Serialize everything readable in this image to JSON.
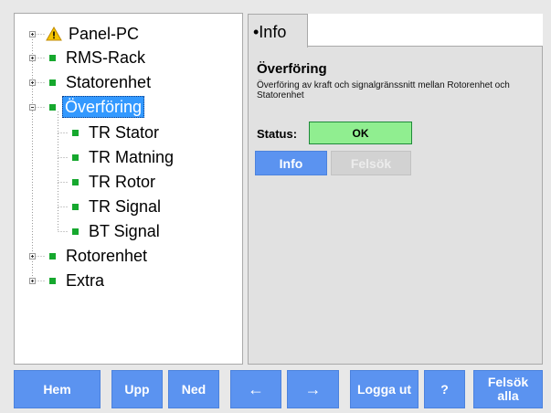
{
  "tree": {
    "items": [
      {
        "label": "Panel-PC",
        "icon": "warning-icon",
        "level": 0,
        "expandable": true,
        "selected": false
      },
      {
        "label": "RMS-Rack",
        "icon": "status-green-icon",
        "level": 0,
        "expandable": true,
        "selected": false
      },
      {
        "label": "Statorenhet",
        "icon": "status-green-icon",
        "level": 0,
        "expandable": true,
        "selected": false
      },
      {
        "label": "Överföring",
        "icon": "status-green-icon",
        "level": 0,
        "expandable": true,
        "selected": true
      },
      {
        "label": "TR Stator",
        "icon": "status-green-icon",
        "level": 1,
        "expandable": false,
        "selected": false
      },
      {
        "label": "TR Matning",
        "icon": "status-green-icon",
        "level": 1,
        "expandable": false,
        "selected": false
      },
      {
        "label": "TR Rotor",
        "icon": "status-green-icon",
        "level": 1,
        "expandable": false,
        "selected": false
      },
      {
        "label": "TR Signal",
        "icon": "status-green-icon",
        "level": 1,
        "expandable": false,
        "selected": false
      },
      {
        "label": "BT Signal",
        "icon": "status-green-icon",
        "level": 1,
        "expandable": false,
        "selected": false
      },
      {
        "label": "Rotorenhet",
        "icon": "status-green-icon",
        "level": 0,
        "expandable": true,
        "selected": false
      },
      {
        "label": "Extra",
        "icon": "status-green-icon",
        "level": 0,
        "expandable": true,
        "selected": false
      }
    ]
  },
  "info": {
    "tab_label": "•Info",
    "title": "Överföring",
    "description": "Överföring av kraft och signalgränssnitt mellan Rotorenhet och Statorenhet",
    "status_label": "Status:",
    "status_value": "OK",
    "info_button": "Info",
    "felsok_button": "Felsök"
  },
  "toolbar": {
    "hem": "Hem",
    "upp": "Upp",
    "ned": "Ned",
    "left": "←",
    "right": "→",
    "logga_ut": "Logga ut",
    "help": "?",
    "felsok_alla": "Felsök alla"
  },
  "colors": {
    "accent": "#5b93f0",
    "status_ok": "#90ee90",
    "node_green": "#16a82e",
    "selection": "#3399ff"
  }
}
